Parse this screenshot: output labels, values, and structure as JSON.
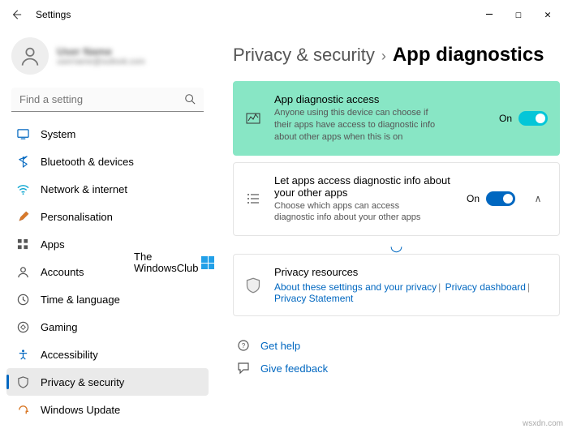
{
  "window": {
    "title": "Settings"
  },
  "user": {
    "name": "User Name",
    "email": "username@outlook.com"
  },
  "search": {
    "placeholder": "Find a setting"
  },
  "nav": {
    "items": [
      {
        "label": "System"
      },
      {
        "label": "Bluetooth & devices"
      },
      {
        "label": "Network & internet"
      },
      {
        "label": "Personalisation"
      },
      {
        "label": "Apps"
      },
      {
        "label": "Accounts"
      },
      {
        "label": "Time & language"
      },
      {
        "label": "Gaming"
      },
      {
        "label": "Accessibility"
      },
      {
        "label": "Privacy & security"
      },
      {
        "label": "Windows Update"
      }
    ]
  },
  "breadcrumb": {
    "parent": "Privacy & security",
    "page": "App diagnostics"
  },
  "cards": {
    "access": {
      "title": "App diagnostic access",
      "desc": "Anyone using this device can choose if their apps have access to diagnostic info about other apps when this is on",
      "state": "On"
    },
    "letapps": {
      "title": "Let apps access diagnostic info about your other apps",
      "desc": "Choose which apps can access diagnostic info about your other apps",
      "state": "On"
    },
    "privacy": {
      "title": "Privacy resources",
      "link1": "About these settings and your privacy",
      "link2": "Privacy dashboard",
      "link3": "Privacy Statement"
    }
  },
  "actions": {
    "help": "Get help",
    "feedback": "Give feedback"
  },
  "watermark": {
    "line1": "The",
    "line2": "WindowsClub"
  },
  "footer": "wsxdn.com"
}
